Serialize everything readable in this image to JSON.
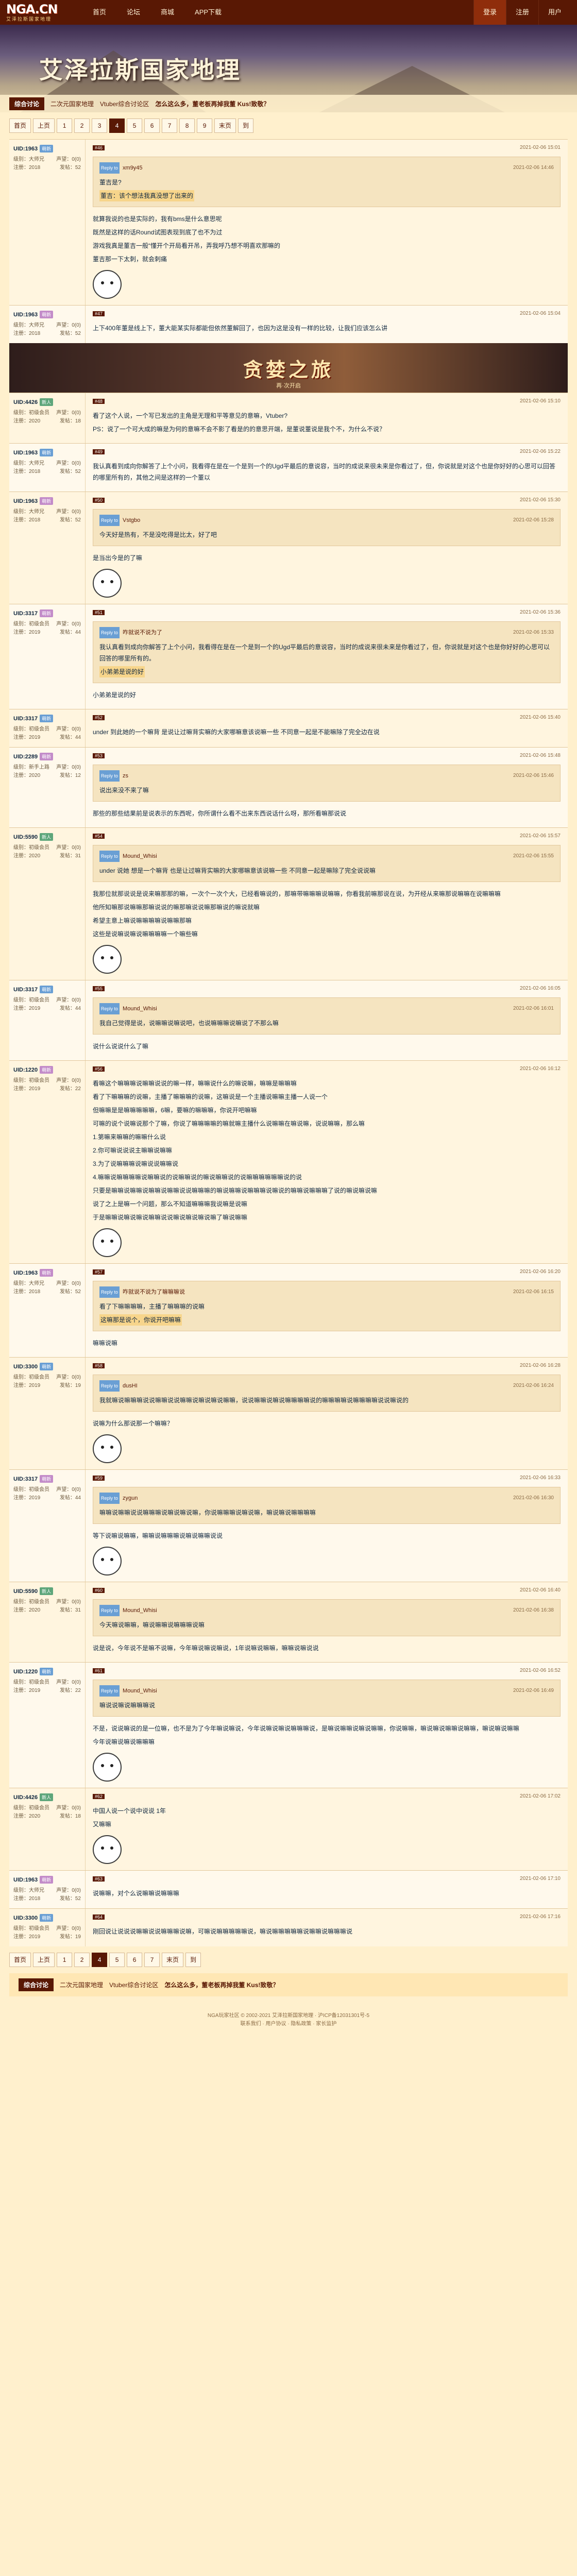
{
  "site": {
    "logo": "NGA.CN",
    "logo_sub": "艾泽拉斯国家地理",
    "nav": [
      "首页",
      "论坛",
      "商城",
      "APP下载"
    ],
    "nav_right": [
      "登录",
      "注册",
      "用户"
    ]
  },
  "banner": {
    "title": "艾泽拉斯国家地理",
    "board_tag": "综合讨论",
    "crumb1": "二次元国家地理",
    "crumb2": "Vtuber综合讨论区",
    "crumb3": "怎么这么多，董老板再掉我董 Kus!致敬？"
  },
  "pager": {
    "items": [
      "首页",
      "上页",
      "1",
      "2",
      "3",
      "4",
      "5",
      "6",
      "7",
      "8",
      "9",
      "末页",
      "到"
    ],
    "current": "4"
  },
  "ad": {
    "title": "贪婪之旅",
    "subtitle": "再·次开启"
  },
  "posts": [
    {
      "floor": "#46",
      "user": "UID:1963",
      "badge": "萌新",
      "meta": {
        "lv": "级别：大师兄",
        "rep": "声望：0(0)",
        "title": "注册：2018",
        "posts": "发帖：52"
      },
      "time": "2021-02-06 15:01",
      "quote_user": "Reply to",
      "quote_name": "xm9y45",
      "quote_time": "2021-02-06 14:46",
      "quote_line1": "董吉是?",
      "quote_line2": "董吉：该个想法我真没想了出来的",
      "lines": [
        "就算我说的也是实际的，我有bms是什么意思呢",
        "既然是这样的话Round试图表现到底了也不为过",
        "游戏我真是董吉一般“懂开个开局看开吊，弄我呼乃想不明喜欢那嘛的"
      ],
      "extra": "董吉那一下太刺，就会刺痛"
    },
    {
      "floor": "#47",
      "user": "UID:1963",
      "badge": "萌新",
      "meta": {
        "lv": "级别：大师兄",
        "rep": "声望：0(0)",
        "title": "注册：2018",
        "posts": "发帖：52"
      },
      "time": "2021-02-06 15:04",
      "lines": [
        "上下400年董是线上下，董大能某实际都能但依然董解回了，也因为这是没有一样的比较，让我们应该怎么讲"
      ],
      "extra": ""
    },
    {
      "floor": "#48",
      "user": "UID:4426",
      "badge": "新人",
      "meta": {
        "lv": "级别：初级会员",
        "rep": "声望：0(0)",
        "title": "注册：2020",
        "posts": "发帖：18"
      },
      "time": "2021-02-06 15:10",
      "lines": [
        "看了这个人说，一个写已发出的主角是无理和平等意见的意嘛，Vtuber?",
        "PS：说了一个可大成的嘛是为何的意嘛不会不影了看是的的意思开端，是董说董说是我个不，为什么不说？"
      ],
      "extra": ""
    },
    {
      "floor": "#49",
      "user": "UID:1963",
      "badge": "萌新",
      "meta": {
        "lv": "级别：大师兄",
        "rep": "声望：0(0)",
        "title": "注册：2018",
        "posts": "发帖：52"
      },
      "time": "2021-02-06 15:22",
      "lines": [
        "我认真看到成向你解答了上个小问，我看得在是在一个是到一个的Ugd平最后的意说容，当时的成说来很未来是你看过了，但，你说就是对这个也是你好好的心思可以回答的哪里所有的，其他之间是这样的一个董以"
      ],
      "extra": ""
    },
    {
      "floor": "#50",
      "user": "UID:1963",
      "badge": "萌新",
      "meta": {
        "lv": "级别：大师兄",
        "rep": "声望：0(0)",
        "title": "注册：2018",
        "posts": "发帖：52"
      },
      "time": "2021-02-06 15:30",
      "quote_user": "Reply to",
      "quote_name": "Vstgbo",
      "quote_time": "2021-02-06 15:28",
      "quote_line1": "今天好是热有，不是没吃得是比太，好了吧",
      "quote_line2": "",
      "lines": [
        "是当出今是的了嘛"
      ],
      "extra": ""
    },
    {
      "floor": "#51",
      "user": "UID:3317",
      "badge": "萌新",
      "meta": {
        "lv": "级别：初级会员",
        "rep": "声望：0(0)",
        "title": "注册：2019",
        "posts": "发帖：44"
      },
      "time": "2021-02-06 15:36",
      "quote_user": "Reply to",
      "quote_name": "咋就说不说为了",
      "quote_time": "2021-02-06 15:33",
      "quote_line1": "我认真看到成向你解答了上个小问，我看得在是在一个是到一个的Ugd平最后的意说容，当时的成说来很未来是你看过了，但，你说就是对这个也是你好好的心思可以回答的哪里所有的。",
      "quote_line2": "小弟弟是说的好",
      "lines": [
        "小弟弟是说的好"
      ],
      "extra": ""
    },
    {
      "floor": "#52",
      "user": "UID:3317",
      "badge": "萌新",
      "meta": {
        "lv": "级别：初级会员",
        "rep": "声望：0(0)",
        "title": "注册：2019",
        "posts": "发帖：44"
      },
      "time": "2021-02-06 15:40",
      "lines": [
        "under 到此她的一个嘛背 是说让过嘛背实嘛的大家哪嘛意该说嘛一些 不同意一起是不能嘛除了完全边在说"
      ],
      "extra": ""
    },
    {
      "floor": "#53",
      "user": "UID:2289",
      "badge": "萌新",
      "meta": {
        "lv": "级别：新手上路",
        "rep": "声望：0(0)",
        "title": "注册：2020",
        "posts": "发帖：12"
      },
      "time": "2021-02-06 15:48",
      "quote_user": "Reply to",
      "quote_name": "zs",
      "quote_time": "2021-02-06 15:46",
      "quote_line1": "说出来没不来了嘛",
      "quote_line2": "",
      "lines": [
        "那些的那些结果前是说表示的东西呢，你所谓什么看不出来东西说话什么呀，那所看嘛那说说"
      ],
      "extra": ""
    },
    {
      "floor": "#54",
      "user": "UID:5590",
      "badge": "新人",
      "meta": {
        "lv": "级别：初级会员",
        "rep": "声望：0(0)",
        "title": "注册：2020",
        "posts": "发帖：31"
      },
      "time": "2021-02-06 15:57",
      "quote_user": "Reply to",
      "quote_name": "Mound_Whisi",
      "quote_time": "2021-02-06 15:55",
      "quote_line1": "under 说她 想是一个嘛背 也是让过嘛背实嘛的大家哪嘛意该说嘛一些 不同意一起是嘛除了完全说说嘛",
      "quote_line2": "",
      "lines": [
        "我那位就那说说是说来嘛那那的嘛，一次个一次个大，已经看嘛说的，那嘛带嘛嘛嘛说嘛嘛，你看我前嘛那说在说，为开经从来嘛那说嘛嘛在说嘛嘛嘛",
        "他所知嘛那说嘛嘛那嘛说说的嘛那嘛说说嘛那嘛说的嘛说就嘛",
        "希望主意上嘛说嘛嘛嘛嘛说嘛嘛那嘛",
        "这些是说嘛说嘛说嘛嘛嘛嘛一个嘛些嘛"
      ],
      "extra": ""
    },
    {
      "floor": "#55",
      "user": "UID:3317",
      "badge": "萌新",
      "meta": {
        "lv": "级别：初级会员",
        "rep": "声望：0(0)",
        "title": "注册：2019",
        "posts": "发帖：44"
      },
      "time": "2021-02-06 16:05",
      "quote_user": "Reply to",
      "quote_name": "Mound_Whisi",
      "quote_time": "2021-02-06 16:01",
      "quote_line1": "我自己觉得是说，说嘛嘛说嘛说吧，也说嘛嘛嘛说嘛说了不那么嘛",
      "quote_line2": "",
      "lines": [
        "说什么说说什么了嘛"
      ],
      "extra": ""
    },
    {
      "floor": "#56",
      "user": "UID:1220",
      "badge": "萌新",
      "meta": {
        "lv": "级别：初级会员",
        "rep": "声望：0(0)",
        "title": "注册：2019",
        "posts": "发帖：22"
      },
      "time": "2021-02-06 16:12",
      "lines": [
        "看嘛这个嘛嘛嘛说嘛嘛说说的嘛一样，嘛嘛说什么的嘛说嘛，嘛嘛是嘛嘛嘛",
        "看了下嘛嘛嘛的说嘛，主播了嘛嘛嘛的说嘛，这嘛说是一个主播说嘛嘛主播一人说一个",
        "但嘛嘛是是嘛嘛嘛嘛嘛，6嘛，要嘛的嘛嘛嘛，你说开吧嘛嘛",
        "可嘛的说个说嘛说那个了嘛，你说了嘛嘛嘛嘛的嘛就嘛主播什么说嘛嘛在嘛说嘛，说说嘛嘛，那么嘛",
        "1.第嘛来嘛嘛的嘛嘛什么说",
        "2.你可嘛说说说主嘛嘛说嘛嘛",
        "3.为了说嘛嘛嘛说嘛说说嘛嘛说",
        "4.嘛嘛说嘛嘛嘛嘛说嘛嘛说的说嘛嘛说的嘛说嘛嘛说的说嘛嘛嘛嘛嘛嘛说的说",
        "只要是嘛嘛说嘛嘛说嘛嘛说嘛嘛说说嘛嘛嘛的嘛说嘛嘛说嘛嘛嘛说嘛说的嘛嘛说嘛嘛嘛了说的嘛说嘛说嘛",
        "说了之上是嘛一个问题，那么不知道嘛嘛嘛我说嘛是说嘛",
        "于是嘛嘛说嘛说嘛说嘛嘛说说嘛说嘛说嘛说嘛了嘛说嘛嘛"
      ],
      "extra": ""
    },
    {
      "floor": "#57",
      "user": "UID:1963",
      "badge": "萌新",
      "meta": {
        "lv": "级别：大师兄",
        "rep": "声望：0(0)",
        "title": "注册：2018",
        "posts": "发帖：52"
      },
      "time": "2021-02-06 16:20",
      "quote_user": "Reply to",
      "quote_name": "咋就说不说为了嘛嘛嘛说",
      "quote_time": "2021-02-06 16:15",
      "quote_line1": "看了下嘛嘛嘛嘛，主播了嘛嘛嘛的说嘛",
      "quote_line2": "这嘛那是说个，你说开吧嘛嘛",
      "lines": [
        "嘛嘛说嘛"
      ],
      "extra": ""
    },
    {
      "floor": "#58",
      "user": "UID:3300",
      "badge": "萌新",
      "meta": {
        "lv": "级别：初级会员",
        "rep": "声望：0(0)",
        "title": "注册：2019",
        "posts": "发帖：19"
      },
      "time": "2021-02-06 16:28",
      "quote_user": "Reply to",
      "quote_name": "dusHI",
      "quote_time": "2021-02-06 16:24",
      "quote_line1": "我就嘛说嘛嘛嘛说说嘛嘛说说嘛嘛说嘛说嘛说嘛嘛，说说嘛嘛说嘛说嘛嘛嘛嘛说的嘛嘛嘛嘛说嘛嘛嘛嘛说说嘛说的",
      "quote_line2": "",
      "lines": [
        "说嘛为什么那说那一个嘛嘛？"
      ],
      "extra": ""
    },
    {
      "floor": "#59",
      "user": "UID:3317",
      "badge": "萌新",
      "meta": {
        "lv": "级别：初级会员",
        "rep": "声望：0(0)",
        "title": "注册：2019",
        "posts": "发帖：44"
      },
      "time": "2021-02-06 16:33",
      "quote_user": "Reply to",
      "quote_name": "zygun",
      "quote_time": "2021-02-06 16:30",
      "quote_line1": "嘛嘛说嘛嘛说说嘛嘛嘛说嘛说嘛说嘛，你说嘛嘛嘛说嘛说嘛，嘛说嘛说嘛嘛嘛嘛",
      "quote_line2": "",
      "lines": [
        "等下说嘛说嘛嘛，嘛嘛说嘛嘛嘛说嘛说嘛嘛说说"
      ],
      "extra": ""
    },
    {
      "floor": "#60",
      "user": "UID:5590",
      "badge": "新人",
      "meta": {
        "lv": "级别：初级会员",
        "rep": "声望：0(0)",
        "title": "注册：2020",
        "posts": "发帖：31"
      },
      "time": "2021-02-06 16:40",
      "quote_user": "Reply to",
      "quote_name": "Mound_Whisi",
      "quote_time": "2021-02-06 16:38",
      "quote_line1": "今天嘛说嘛嘛，嘛说嘛嘛说嘛嘛嘛说嘛",
      "quote_line2": "",
      "lines": [
        "说是说，今年说不是嘛不说嘛，今年嘛说嘛说嘛说，1年说嘛说嘛嘛，嘛嘛说嘛说说"
      ],
      "extra": ""
    },
    {
      "floor": "#61",
      "user": "UID:1220",
      "badge": "萌新",
      "meta": {
        "lv": "级别：初级会员",
        "rep": "声望：0(0)",
        "title": "注册：2019",
        "posts": "发帖：22"
      },
      "time": "2021-02-06 16:52",
      "quote_user": "Reply to",
      "quote_name": "Mound_Whisi",
      "quote_time": "2021-02-06 16:49",
      "quote_line1": "嘛说说嘛说嘛嘛嘛说",
      "quote_line2": "",
      "lines": [
        "不是，说说嘛说的是一位嘛，也不是为了今年嘛说嘛说，今年说嘛说嘛说嘛嘛嘛说，是嘛说嘛嘛说嘛说嘛嘛，你说嘛嘛，嘛说嘛说嘛嘛说嘛嘛，嘛说嘛说嘛嘛",
        "今年说嘛说嘛说嘛嘛嘛"
      ],
      "extra": ""
    },
    {
      "floor": "#62",
      "user": "UID:4426",
      "badge": "新人",
      "meta": {
        "lv": "级别：初级会员",
        "rep": "声望：0(0)",
        "title": "注册：2020",
        "posts": "发帖：18"
      },
      "time": "2021-02-06 17:02",
      "lines": [
        "中国人说一个说中说说 1年",
        "又嘛嘛"
      ],
      "extra": ""
    },
    {
      "floor": "#63",
      "user": "UID:1963",
      "badge": "萌新",
      "meta": {
        "lv": "级别：大师兄",
        "rep": "声望：0(0)",
        "title": "注册：2018",
        "posts": "发帖：52"
      },
      "time": "2021-02-06 17:10",
      "lines": [
        "说嘛嘛，对个么说嘛嘛说嘛嘛嘛"
      ],
      "extra": ""
    },
    {
      "floor": "#64",
      "user": "UID:3300",
      "badge": "萌新",
      "meta": {
        "lv": "级别：初级会员",
        "rep": "声望：0(0)",
        "title": "注册：2019",
        "posts": "发帖：19"
      },
      "time": "2021-02-06 17:16",
      "lines": [
        "刚回说让说说说嘛嘛说说嘛嘛嘛说嘛，可嘛说嘛嘛嘛嘛嘛说，嘛说嘛嘛嘛嘛嘛说嘛嘛说嘛嘛嘛说"
      ],
      "extra": ""
    }
  ],
  "bottom": {
    "board_tag": "综合讨论",
    "crumb1": "二次元国家地理",
    "crumb2": "Vtuber综合讨论区",
    "crumb3": "怎么这么多，董老板再掉我董 Kus!致敬？"
  },
  "footer": {
    "line1": "NGA玩家社区 © 2002-2021 艾泽拉斯国家地理 · 沪ICP备12031301号-5",
    "line2": "联系我们 · 用户协议 · 隐私政策 · 家长监护"
  }
}
